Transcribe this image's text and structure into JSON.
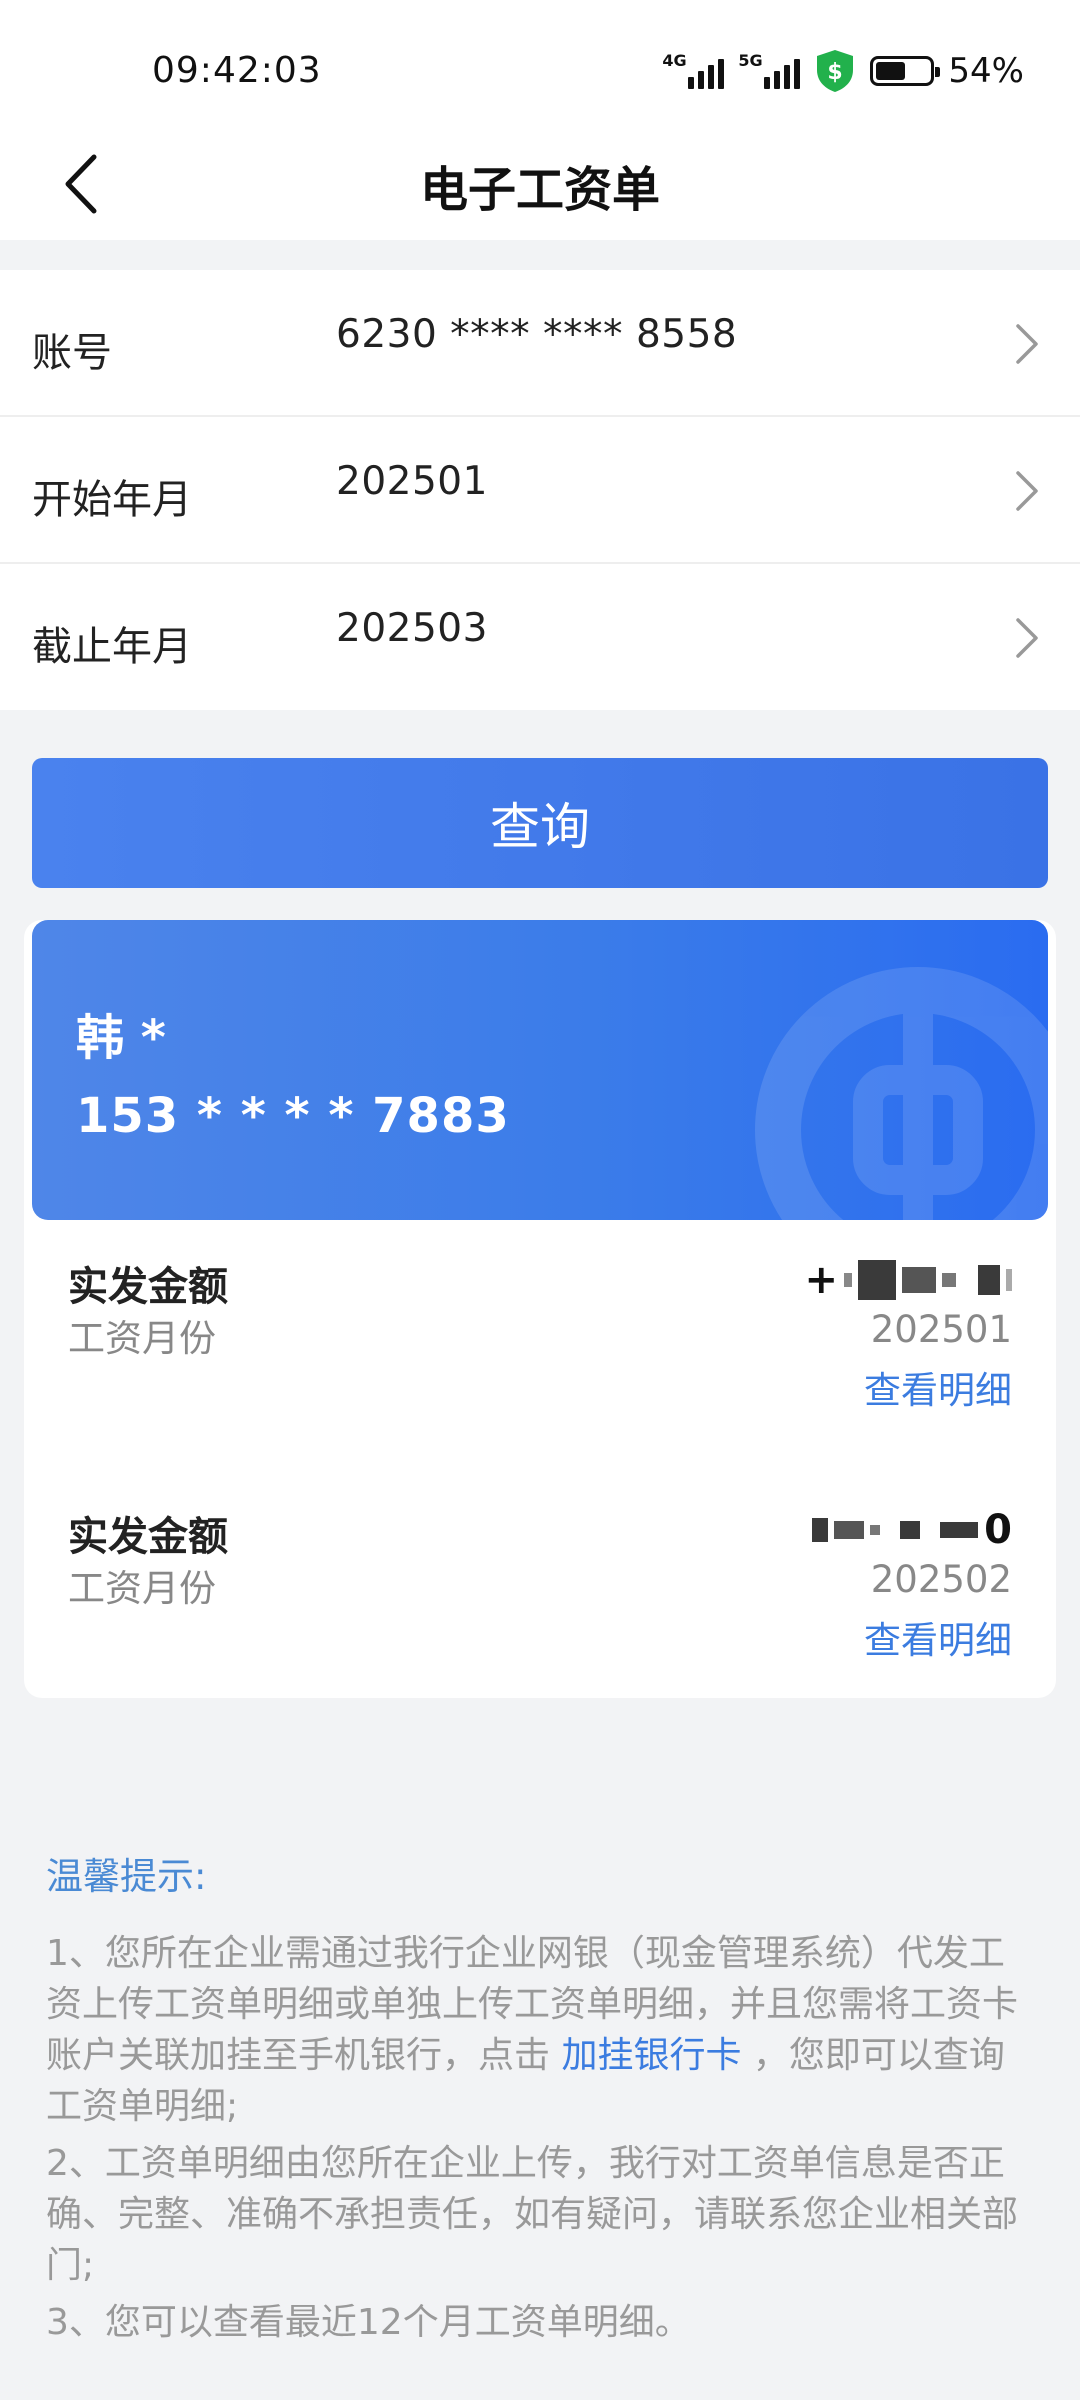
{
  "status_bar": {
    "time": "09:42:03",
    "signal_1_tag": "4G",
    "signal_2_tag": "5G",
    "battery_percent": "54%",
    "battery_level": 0.54,
    "icons": [
      "signal-4g-icon",
      "signal-5g-icon",
      "shield-dollar-icon",
      "battery-icon"
    ]
  },
  "header": {
    "title": "电子工资单",
    "back_icon": "chevron-left-icon"
  },
  "form": {
    "rows": [
      {
        "label": "账号",
        "value": "6230 **** **** 8558"
      },
      {
        "label": "开始年月",
        "value": "202501"
      },
      {
        "label": "截止年月",
        "value": "202503"
      }
    ],
    "chevron_icon": "chevron-right-icon"
  },
  "query_button": {
    "label": "查询"
  },
  "profile": {
    "name": "韩 *",
    "phone": "153 * * * * 7883",
    "watermark_icon": "bank-logo-icon"
  },
  "payslips": [
    {
      "amount_label": "实发金额",
      "amount_visible_prefix": "+",
      "month_label": "工资月份",
      "month": "202501",
      "detail_link": "查看明细"
    },
    {
      "amount_label": "实发金额",
      "amount_visible_suffix": "0",
      "month_label": "工资月份",
      "month": "202502",
      "detail_link": "查看明细"
    }
  ],
  "tips": {
    "title": "温馨提示:",
    "item1_before": "1、您所在企业需通过我行企业网银（现金管理系统）代发工资上传工资单明细或单独上传工资单明细，并且您需将工资卡账户关联加挂至手机银行，点击",
    "item1_link": " 加挂银行卡 ",
    "item1_after": "，您即可以查询工资单明细;",
    "item2": "2、工资单明细由您所在企业上传，我行对工资单信息是否正确、完整、准确不承担责任，如有疑问，请联系您企业相关部门;",
    "item3": "3、您可以查看最近12个月工资单明细。"
  },
  "colors": {
    "primary": "#3b7ce0",
    "banner": "#3b7ce9",
    "background": "#f2f3f5",
    "tip_title": "#4a8ad4"
  }
}
